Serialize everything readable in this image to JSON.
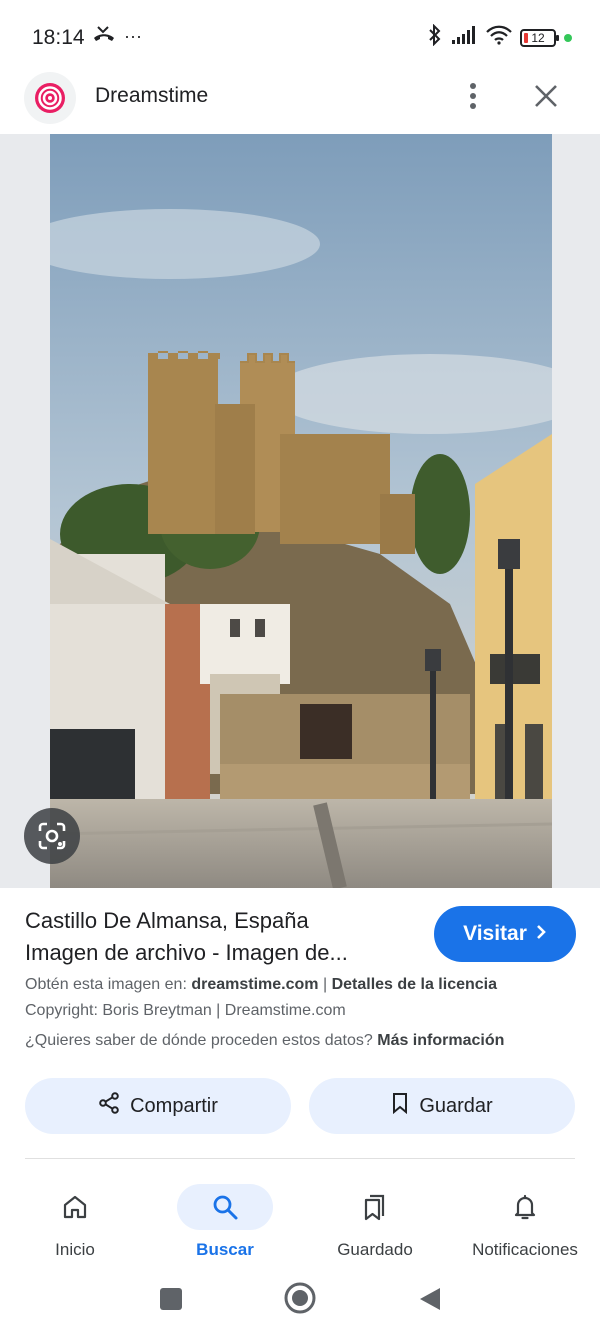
{
  "status_bar": {
    "time": "18:14",
    "left_icons": [
      "missed-call-icon",
      "more-dots"
    ],
    "more": "···",
    "battery": "12"
  },
  "header": {
    "site_name": "Dreamstime",
    "logo_icon": "dreamstime-logo",
    "menu_icon": "more-vert-icon",
    "close_icon": "close-icon"
  },
  "result": {
    "title_line1": "Castillo De Almansa, España",
    "title_line2": "Imagen de archivo - Imagen de...",
    "visit_label": "Visitar",
    "source_prefix": "Obtén esta imagen en:",
    "source_site": "dreamstime.com",
    "separator": "|",
    "license_link": "Detalles de la licencia",
    "copyright": "Copyright: Boris Breytman | Dreamstime.com",
    "data_question": "¿Quieres saber de dónde proceden estos datos?",
    "more_info_link": "Más información",
    "share_label": "Compartir",
    "save_label": "Guardar"
  },
  "bottom_nav": {
    "items": [
      {
        "label": "Inicio",
        "icon": "home-icon"
      },
      {
        "label": "Buscar",
        "icon": "search-icon",
        "active": true
      },
      {
        "label": "Guardado",
        "icon": "bookmarks-icon"
      },
      {
        "label": "Notificaciones",
        "icon": "bell-icon"
      }
    ]
  },
  "system_nav": {
    "icons": [
      "recents-square-icon",
      "home-circle-icon",
      "back-triangle-icon"
    ]
  },
  "colors": {
    "accent": "#1a73e8",
    "chip_bg": "#e8f0fe",
    "logo_pink": "#e91e63"
  }
}
